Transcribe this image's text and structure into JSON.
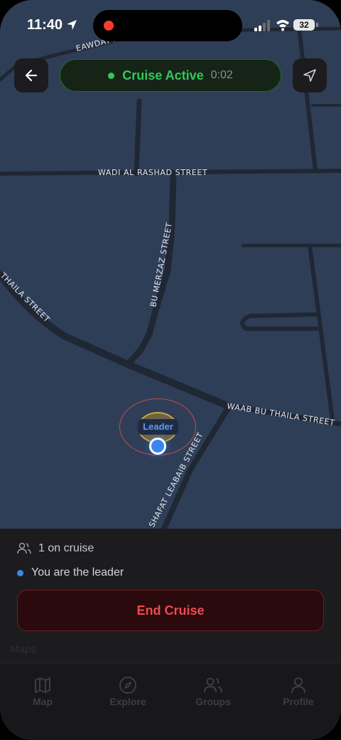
{
  "status_bar": {
    "time": "11:40",
    "battery": "32"
  },
  "header": {
    "cruise_status": "Cruise Active",
    "timer": "0:02"
  },
  "map": {
    "streets": [
      "EAWDAT AL",
      "WADI AL RASHAD STREET",
      "BU MERZAZ STREET",
      "THAILA STREET",
      "WAAB BU THAILA STREET",
      "SHAFAT LEABAIB STREET"
    ],
    "marker_label": "Leader"
  },
  "panel": {
    "cruise_count": "1 on cruise",
    "leader_status": "You are the leader",
    "end_button": "End Cruise",
    "ghost_text": "Maps"
  },
  "tabs": [
    {
      "label": "Map",
      "icon": "map-icon"
    },
    {
      "label": "Explore",
      "icon": "compass-icon"
    },
    {
      "label": "Groups",
      "icon": "users-icon"
    },
    {
      "label": "Profile",
      "icon": "person-icon"
    }
  ],
  "colors": {
    "map_bg": "#2f3e57",
    "road": "#202734",
    "active_green": "#34c759",
    "end_red": "#ee4a4f",
    "leader_blue": "#3a86ef"
  }
}
